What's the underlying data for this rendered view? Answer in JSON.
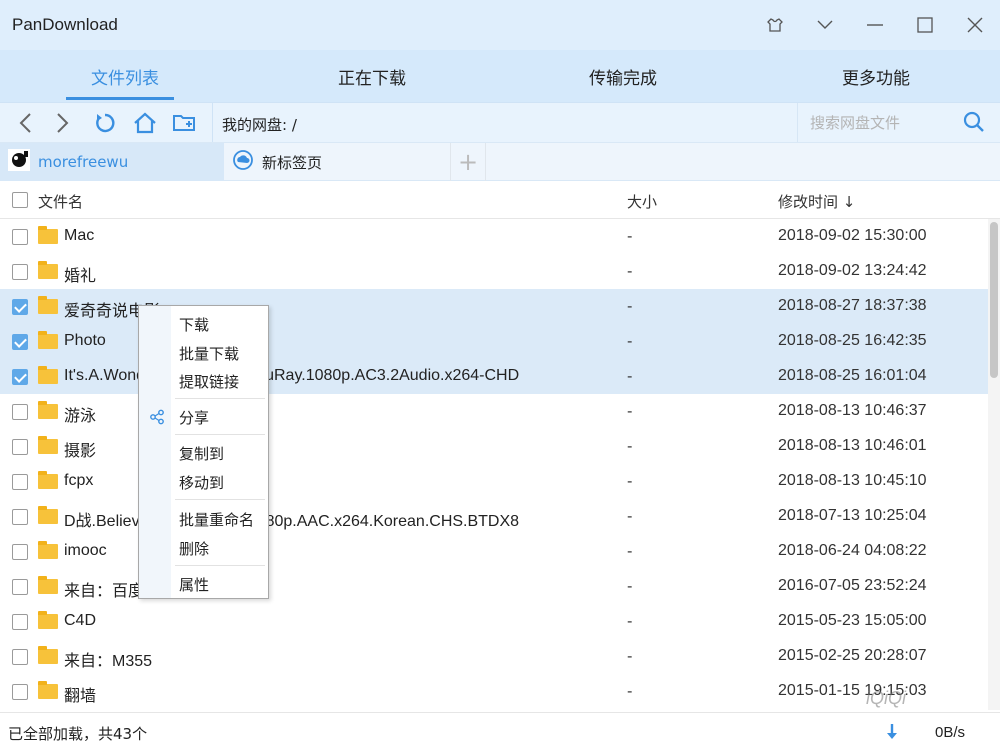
{
  "app": {
    "title": "PanDownload"
  },
  "window_controls": [
    {
      "name": "skin-icon",
      "glyph": "⌂"
    },
    {
      "name": "chevron-down-icon",
      "glyph": "⌄"
    },
    {
      "name": "minimize-icon",
      "glyph": "—"
    },
    {
      "name": "maximize-icon",
      "glyph": "☐"
    },
    {
      "name": "close-icon",
      "glyph": "✕"
    }
  ],
  "main_tabs": [
    {
      "label": "文件列表",
      "active": true
    },
    {
      "label": "正在下载",
      "active": false
    },
    {
      "label": "传输完成",
      "active": false
    },
    {
      "label": "更多功能",
      "active": false
    }
  ],
  "toolbar": {
    "path": "我的网盘: /",
    "search_placeholder": "搜索网盘文件"
  },
  "drive_tabs": [
    {
      "label": "morefreewu",
      "active": true,
      "icon": "avatar"
    },
    {
      "label": "新标签页",
      "active": false,
      "icon": "cloud-icon"
    }
  ],
  "list_header": {
    "name": "文件名",
    "size": "大小",
    "mtime": "修改时间 ↓"
  },
  "files": [
    {
      "name": "Mac",
      "size": "-",
      "mtime": "2018-09-02 15:30:00",
      "checked": false
    },
    {
      "name": "婚礼",
      "size": "-",
      "mtime": "2018-09-02 13:24:42",
      "checked": false
    },
    {
      "name": "爱奇奇说电影",
      "size": "-",
      "mtime": "2018-08-27 18:37:38",
      "checked": true
    },
    {
      "name": "Photo",
      "size": "-",
      "mtime": "2018-08-25 16:42:35",
      "checked": true
    },
    {
      "name": "It's.A.Wonderful.Life.1946.BluRay.1080p.AC3.2Audio.x264-CHD",
      "size": "-",
      "mtime": "2018-08-25 16:01:04",
      "checked": true
    },
    {
      "name": "游泳",
      "size": "-",
      "mtime": "2018-08-13 10:46:37",
      "checked": false
    },
    {
      "name": "摄影",
      "size": "-",
      "mtime": "2018-08-13 10:46:01",
      "checked": false
    },
    {
      "name": "fcpx",
      "size": "-",
      "mtime": "2018-08-13 10:45:10",
      "checked": false
    },
    {
      "name": "D战.Believe.2007.BluRay.1080p.AAC.x264.Korean.CHS.BTDX8",
      "size": "-",
      "mtime": "2018-07-13 10:25:04",
      "checked": false
    },
    {
      "name": "imooc",
      "size": "-",
      "mtime": "2018-06-24 04:08:22",
      "checked": false
    },
    {
      "name": "来自：百度",
      "size": "-",
      "mtime": "2016-07-05 23:52:24",
      "checked": false
    },
    {
      "name": "C4D",
      "size": "-",
      "mtime": "2015-05-23 15:05:00",
      "checked": false
    },
    {
      "name": "来自：M355",
      "size": "-",
      "mtime": "2015-02-25 20:28:07",
      "checked": false
    },
    {
      "name": "翻墙",
      "size": "-",
      "mtime": "2015-01-15 19:15:03",
      "checked": false
    }
  ],
  "context_menu": {
    "items": [
      {
        "label": "下载",
        "group": 1
      },
      {
        "label": "批量下载",
        "group": 1
      },
      {
        "label": "提取链接",
        "group": 1
      },
      {
        "label": "分享",
        "group": 2,
        "icon": "share-icon"
      },
      {
        "label": "复制到",
        "group": 3
      },
      {
        "label": "移动到",
        "group": 3
      },
      {
        "label": "批量重命名",
        "group": 4
      },
      {
        "label": "删除",
        "group": 4
      },
      {
        "label": "属性",
        "group": 5
      }
    ]
  },
  "status": {
    "text": "已全部加载，共43个",
    "speed": "0B/s"
  },
  "watermark": "iQiQi",
  "colors": {
    "accent": "#3a8fe0",
    "titlebar_bg": "#dfeefc",
    "tabs_bg": "#d5e9fb",
    "selected_row": "#dbeaf8",
    "folder": "#f7c23a"
  }
}
